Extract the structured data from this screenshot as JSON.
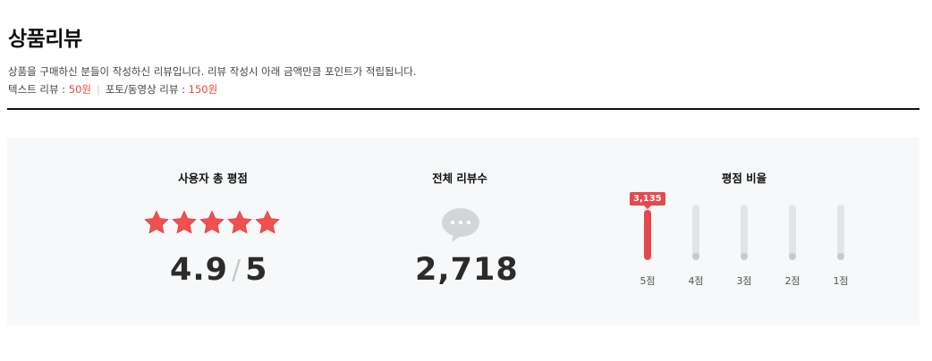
{
  "header": {
    "title": "상품리뷰",
    "desc_line1": "상품을 구매하신 분들이 작성하신 리뷰입니다. 리뷰 작성시 아래 금액만큼 포인트가 적립됩니다.",
    "text_review_label": "텍스트 리뷰 : ",
    "text_review_point": "50원",
    "separator": "|",
    "photo_review_label": "포토/동영상 리뷰 : ",
    "photo_review_point": "150원"
  },
  "summary": {
    "rating_title": "사용자 총 평점",
    "stars_filled": 5,
    "stars_total": 5,
    "score": "4.9",
    "score_slash": "/",
    "score_max": "5",
    "count_title": "전체 리뷰수",
    "count_icon": "speech-bubble-icon",
    "review_count": "2,718",
    "ratio_title": "평점 비율"
  },
  "rating_ratio": {
    "active_color": "#e5484d",
    "inactive_color": "#e3e4ea",
    "bars": [
      {
        "label": "5점",
        "value": 3135,
        "tooltip": "3,135",
        "fill_fraction": 0.9,
        "active": true
      },
      {
        "label": "4점",
        "value": null,
        "fill_fraction": 0,
        "active": false
      },
      {
        "label": "3점",
        "value": null,
        "fill_fraction": 0,
        "active": false
      },
      {
        "label": "2점",
        "value": null,
        "fill_fraction": 0,
        "active": false
      },
      {
        "label": "1점",
        "value": null,
        "fill_fraction": 0,
        "active": false
      }
    ]
  },
  "colors": {
    "star": "#f24f4f",
    "price": "#e24a3b",
    "panel_bg": "#f7f8f9"
  }
}
